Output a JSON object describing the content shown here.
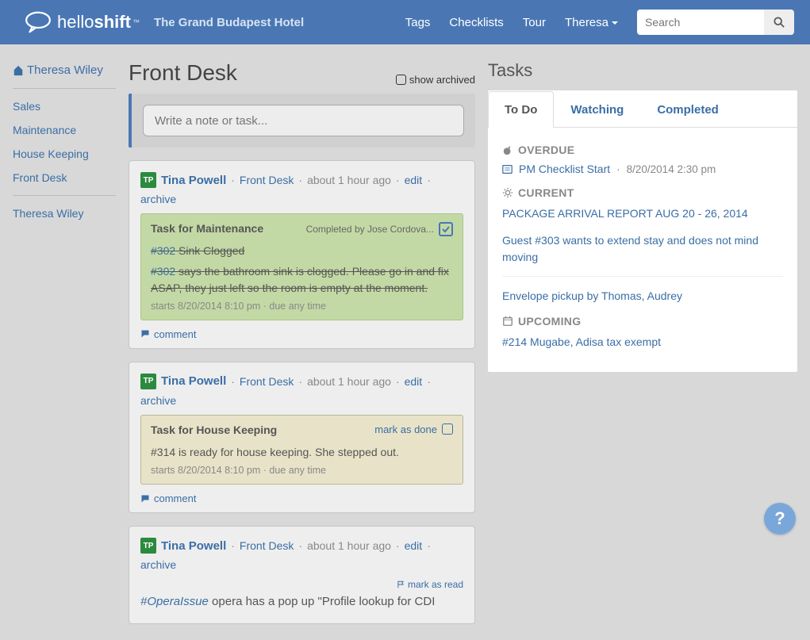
{
  "brand": {
    "name_a": "hello",
    "name_b": "shift",
    "tm": "™"
  },
  "hotel_name": "The Grand Budapest Hotel",
  "nav": {
    "tags": "Tags",
    "checklists": "Checklists",
    "tour": "Tour",
    "user": "Theresa"
  },
  "search": {
    "placeholder": "Search"
  },
  "sidebar": {
    "user": "Theresa Wiley",
    "links": [
      "Sales",
      "Maintenance",
      "House Keeping",
      "Front Desk"
    ],
    "bottom": "Theresa Wiley"
  },
  "page": {
    "title": "Front Desk",
    "show_archived": "show archived",
    "compose_placeholder": "Write a note or task..."
  },
  "posts": [
    {
      "avatar": "TP",
      "author": "Tina Powell",
      "dept": "Front Desk",
      "time": "about 1 hour ago",
      "edit": "edit",
      "archive": "archive",
      "task": {
        "style": "green",
        "title": "Task for Maintenance",
        "completed_by": "Completed by Jose Cordova...",
        "line1_tag": "#302",
        "line1_rest": " Sink Clogged",
        "body_tag": "#302 ",
        "body_rest": " says the bathroom sink is clogged. Please go in and fix ASAP, they just left so the room is empty at the moment.",
        "meta": "starts 8/20/2014 8:10 pm · due any time",
        "struck": true
      },
      "comment": "comment"
    },
    {
      "avatar": "TP",
      "author": "Tina Powell",
      "dept": "Front Desk",
      "time": "about 1 hour ago",
      "edit": "edit",
      "archive": "archive",
      "task": {
        "style": "tan",
        "title": "Task for House Keeping",
        "mark_done": "mark as done",
        "body_plain": "#314 is ready for house keeping. She stepped out.",
        "meta": "starts 8/20/2014 8:10 pm · due any time"
      },
      "comment": "comment"
    },
    {
      "avatar": "TP",
      "author": "Tina Powell",
      "dept": "Front Desk",
      "time": "about 1 hour ago",
      "edit": "edit",
      "archive": "archive",
      "mark_read": "mark as read",
      "body_tag": "#OperaIssue",
      "body_rest": "  opera has a pop up \"Profile lookup for CDI"
    }
  ],
  "tasks_panel": {
    "heading": "Tasks",
    "tabs": {
      "todo": "To Do",
      "watching": "Watching",
      "completed": "Completed"
    },
    "overdue_label": "OVERDUE",
    "overdue": [
      {
        "title": "PM Checklist Start",
        "date": "8/20/2014 2:30 pm"
      }
    ],
    "current_label": "CURRENT",
    "current": [
      "PACKAGE ARRIVAL REPORT AUG 20 - 26, 2014",
      "Guest #303 wants to extend stay and does not mind moving",
      "Envelope pickup by Thomas, Audrey"
    ],
    "upcoming_label": "UPCOMING",
    "upcoming": [
      "#214 Mugabe, Adisa tax exempt"
    ]
  },
  "help": "?"
}
